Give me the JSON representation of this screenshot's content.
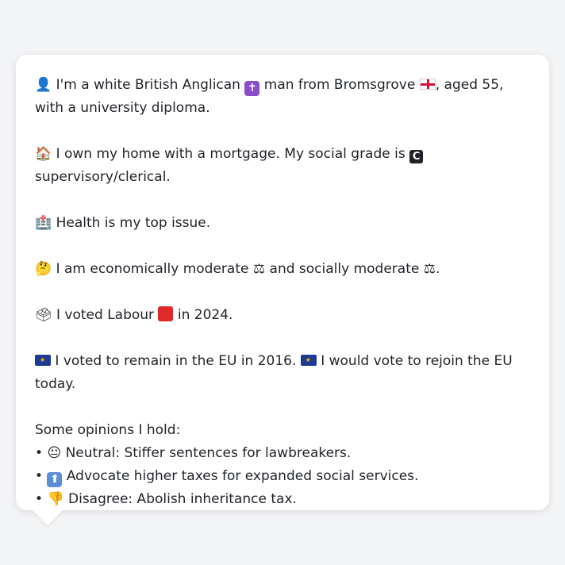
{
  "profile": {
    "line1": {
      "icon": "person-silhouette-icon",
      "text_a": "I'm a white British Anglican",
      "text_b": "man from Bromsgrove",
      "text_c": ", aged 55, with a university diploma."
    },
    "line2": {
      "icon": "house-icon",
      "text_a": "I own my home with a mortgage. My social grade is",
      "grade_letter": "C",
      "text_b": "supervisory/clerical."
    },
    "line3": {
      "icon": "hospital-icon",
      "text": "Health is my top issue."
    },
    "line4": {
      "icon": "thinking-face-icon",
      "text_a": "I am economically moderate",
      "text_b": "and socially moderate",
      "text_c": "."
    },
    "line5": {
      "icon": "ballot-box-icon",
      "text_a": "I voted Labour",
      "text_b": "in 2024."
    },
    "line6": {
      "text_a": "I voted to remain in the EU in 2016.",
      "text_b": "I would vote to rejoin the EU today."
    },
    "opinions": {
      "heading": "Some opinions I hold:",
      "items": [
        {
          "bullet": "•",
          "icon": "neutral-face-icon",
          "text": "Neutral: Stiffer sentences for lawbreakers."
        },
        {
          "bullet": "•",
          "icon": "up-arrow-icon",
          "text": "Advocate higher taxes for expanded social services."
        },
        {
          "bullet": "•",
          "icon": "thumbs-down-icon",
          "text": "Disagree: Abolish inheritance tax."
        }
      ]
    }
  },
  "colors": {
    "background": "#f3f4f6",
    "bubble": "#ffffff",
    "text": "#1f2328",
    "labour_red": "#e02a2a",
    "eu_blue": "#1f3a93"
  }
}
